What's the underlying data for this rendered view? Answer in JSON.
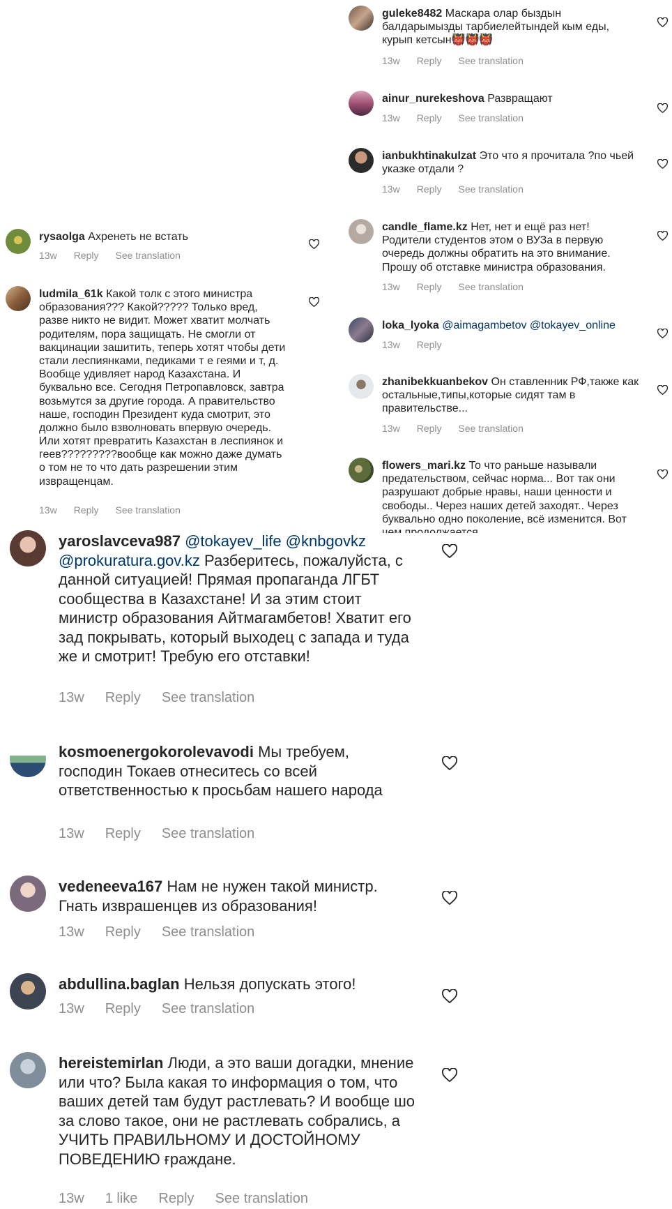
{
  "right_column": [
    {
      "username": "guleke8482",
      "text": "Маскара олар быздын балдарымызды тарбиелейтындей кым еды, курып кетсын👹👹👹",
      "time": "13w",
      "reply": "Reply",
      "translate": "See translation"
    },
    {
      "username": "ainur_nurekeshova",
      "text": "Развращают",
      "time": "13w",
      "reply": "Reply",
      "translate": "See translation"
    },
    {
      "username": "ianbukhtinakulzat",
      "text": "Это что я прочитала ?по чьей указке отдали ?",
      "time": "13w",
      "reply": "Reply",
      "translate": "See translation"
    },
    {
      "username": "candle_flame.kz",
      "text": "Нет, нет и ещё раз нет! Родители студентов этом о ВУЗа в первую очередь должны обратить на это внимание. Прошу об отставке министра образования.",
      "time": "13w",
      "reply": "Reply",
      "translate": "See translation"
    },
    {
      "username": "loka_lyoka",
      "mentions": "@aimagambetov @tokayev_online",
      "time": "13w",
      "reply": "Reply"
    },
    {
      "username": "zhanibekkuanbekov",
      "text": "Он ставленник РФ,также как остальные,типы,которые сидят там в правительстве...",
      "time": "13w",
      "reply": "Reply",
      "translate": "See translation"
    },
    {
      "username": "flowers_mari.kz",
      "text": "То что раньше называли предательством, сейчас норма... Вот так они разрушают добрые нравы, наши ценности и свободы.. Через наших детей заходят.. Через буквально одно поколение, всё изменится. Вот чем продолжается"
    }
  ],
  "left_column": [
    {
      "username": "rysaolga",
      "text": "Ахренеть не встать",
      "time": "13w",
      "reply": "Reply",
      "translate": "See translation"
    },
    {
      "username": "ludmila_61k",
      "text": "Какой толк с этого министра образования??? Какой????? Только вред, разве никто не видит. Может хватит молчать родителям, пора защищать. Не смогли от вакцинации зашитить, теперь хотят чтобы дети стали леспиянками, педиками т е геями и т, д. Вообще удивляет народ Казахстана. И буквально все. Сегодня Петропавловск, завтра возьмутся за другие города. А правительство наше, господин Президент куда смотрит, это должно было взволновать впервую очередь. Или хотят превратить Казахстан в леспиянок и геев?????????вообще как можно даже думать о том не то что дать разрешении этим извращенцам.",
      "time": "13w",
      "reply": "Reply",
      "translate": "See translation"
    }
  ],
  "large_column": [
    {
      "username": "yaroslavceva987",
      "mentions": "@tokayev_life @knbgovkz @prokuratura.gov.kz",
      "text": "Разберитесь, пожалуйста, с данной ситуацией! Прямая пропаганда ЛГБТ сообщества в Казахстане! И за этим стоит министр образования Айтмагамбетов! Хватит его зад покрывать, который выходец с запада и туда же и смотрит! Требую его отставки!",
      "time": "13w",
      "reply": "Reply",
      "translate": "See translation"
    },
    {
      "username": "kosmoenergokorolevavodi",
      "text": "Мы требуем, господин Токаев отнеситесь со всей ответственностью к просьбам нашего народа",
      "time": "13w",
      "reply": "Reply",
      "translate": "See translation"
    },
    {
      "username": "vedeneeva167",
      "text": "Нам не нужен такой министр. Гнать изврашенцев из образования!",
      "time": "13w",
      "reply": "Reply",
      "translate": "See translation"
    },
    {
      "username": "abdullina.baglan",
      "text": "Нельзя допускать этого!",
      "time": "13w",
      "reply": "Reply",
      "translate": "See translation"
    },
    {
      "username": "hereistemirlan",
      "text": "Люди, а это ваши догадки, мнение или что? Была какая то информация о том, что ваших детей там будут растлевать? И вообще шо за слово такое, они не растлевать собрались, а УЧИТЬ ПРАВИЛЬНОМУ И ДОСТОЙНОМУ ПОВЕДЕНИЮ ғраждане.",
      "time": "13w",
      "likes": "1 like",
      "reply": "Reply",
      "translate": "See translation"
    }
  ],
  "icons": {
    "like": "heart-outline-icon"
  },
  "colors": {
    "text": "#262626",
    "meta": "#8e8e8e",
    "mention": "#00376b"
  }
}
